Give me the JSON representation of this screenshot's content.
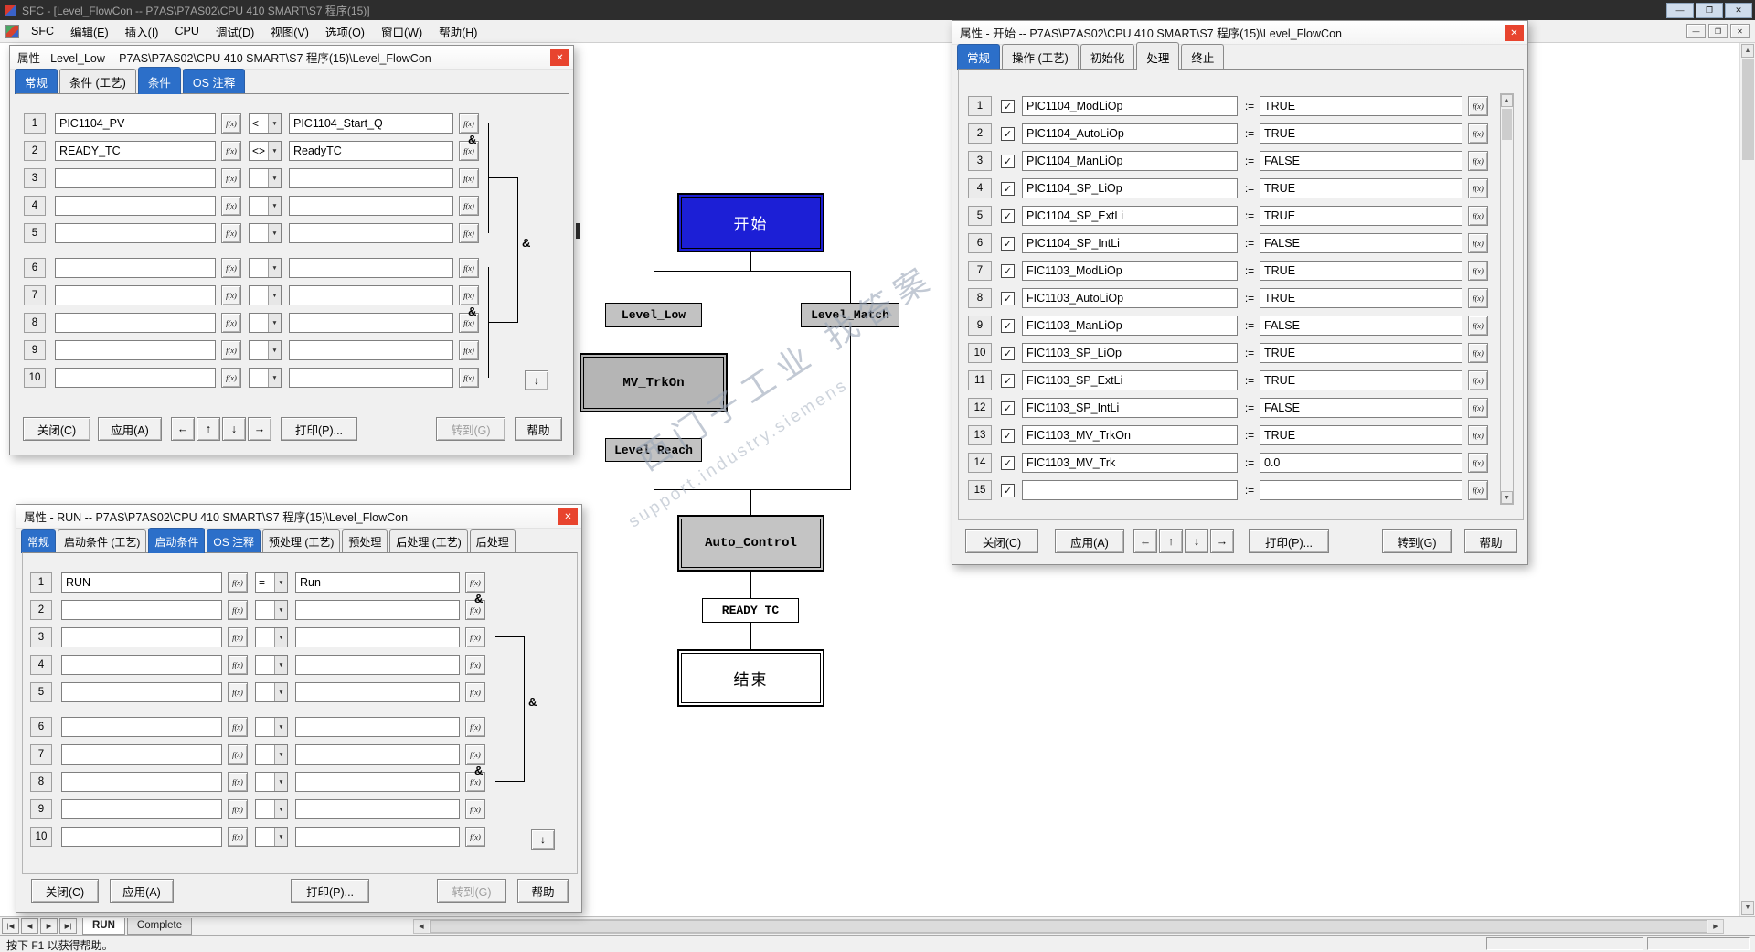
{
  "titlebar": {
    "title": "SFC - [Level_FlowCon -- P7AS\\P7AS02\\CPU 410 SMART\\S7 程序(15)]"
  },
  "menubar": {
    "items": [
      "SFC",
      "编辑(E)",
      "插入(I)",
      "CPU",
      "调试(D)",
      "视图(V)",
      "选项(O)",
      "窗口(W)",
      "帮助(H)"
    ]
  },
  "symbols": {
    "and": "&",
    "fx": "f(x)",
    "assign": ":=",
    "check": "✓",
    "arrow_left": "←",
    "arrow_up": "↑",
    "arrow_down": "↓",
    "arrow_right": "→"
  },
  "icons": {
    "minimize": "—",
    "restore": "❐",
    "close": "✕",
    "scroll_up": "▲",
    "scroll_down": "▼",
    "combo_arrow": "▼",
    "nav_first": "|◀",
    "nav_prev": "◀",
    "nav_next": "▶",
    "nav_last": "▶|",
    "hscroll_left": "◀",
    "hscroll_right": "▶"
  },
  "flowchart": {
    "start": "开始",
    "level_low": "Level_Low",
    "level_match": "Level_Match",
    "mv_trkon": "MV_TrkOn",
    "level_reach": "Level_Reach",
    "auto_control": "Auto_Control",
    "ready_tc": "READY_TC",
    "end": "结束"
  },
  "watermark": {
    "line1": "西门子工业 找答案",
    "line2": "support.industry.siemens"
  },
  "dialog_level_low": {
    "title": "属性 - Level_Low -- P7AS\\P7AS02\\CPU 410 SMART\\S7 程序(15)\\Level_FlowCon",
    "tabs": [
      {
        "label": "常规",
        "blue": true
      },
      {
        "label": "条件 (工艺)"
      },
      {
        "label": "条件",
        "blue": true,
        "active": true
      },
      {
        "label": "OS 注释",
        "blue": true
      }
    ],
    "rows": [
      {
        "n": "1",
        "lhs": "PIC1104_PV",
        "op": "<",
        "rhs": "PIC1104_Start_Q"
      },
      {
        "n": "2",
        "lhs": "READY_TC",
        "op": "<>",
        "rhs": "ReadyTC"
      },
      {
        "n": "3",
        "lhs": "",
        "op": "",
        "rhs": ""
      },
      {
        "n": "4",
        "lhs": "",
        "op": "",
        "rhs": ""
      },
      {
        "n": "5",
        "lhs": "",
        "op": "",
        "rhs": ""
      },
      {
        "n": "6",
        "lhs": "",
        "op": "",
        "rhs": ""
      },
      {
        "n": "7",
        "lhs": "",
        "op": "",
        "rhs": ""
      },
      {
        "n": "8",
        "lhs": "",
        "op": "",
        "rhs": ""
      },
      {
        "n": "9",
        "lhs": "",
        "op": "",
        "rhs": ""
      },
      {
        "n": "10",
        "lhs": "",
        "op": "",
        "rhs": ""
      }
    ],
    "buttons": {
      "close": "关闭(C)",
      "apply": "应用(A)",
      "print": "打印(P)...",
      "goto": "转到(G)",
      "help": "帮助"
    }
  },
  "dialog_run": {
    "title": "属性 - RUN -- P7AS\\P7AS02\\CPU 410 SMART\\S7 程序(15)\\Level_FlowCon",
    "tabs": [
      {
        "label": "常规",
        "blue": true
      },
      {
        "label": "启动条件 (工艺)"
      },
      {
        "label": "启动条件",
        "blue": true,
        "active": true
      },
      {
        "label": "OS 注释",
        "blue": true
      },
      {
        "label": "预处理 (工艺)"
      },
      {
        "label": "预处理"
      },
      {
        "label": "后处理 (工艺)"
      },
      {
        "label": "后处理"
      }
    ],
    "rows": [
      {
        "n": "1",
        "lhs": "RUN",
        "op": "=",
        "rhs": "Run"
      },
      {
        "n": "2",
        "lhs": "",
        "op": "",
        "rhs": ""
      },
      {
        "n": "3",
        "lhs": "",
        "op": "",
        "rhs": ""
      },
      {
        "n": "4",
        "lhs": "",
        "op": "",
        "rhs": ""
      },
      {
        "n": "5",
        "lhs": "",
        "op": "",
        "rhs": ""
      },
      {
        "n": "6",
        "lhs": "",
        "op": "",
        "rhs": ""
      },
      {
        "n": "7",
        "lhs": "",
        "op": "",
        "rhs": ""
      },
      {
        "n": "8",
        "lhs": "",
        "op": "",
        "rhs": ""
      },
      {
        "n": "9",
        "lhs": "",
        "op": "",
        "rhs": ""
      },
      {
        "n": "10",
        "lhs": "",
        "op": "",
        "rhs": ""
      }
    ],
    "buttons": {
      "close": "关闭(C)",
      "apply": "应用(A)",
      "print": "打印(P)...",
      "goto": "转到(G)",
      "help": "帮助"
    }
  },
  "dialog_start": {
    "title": "属性 - 开始 -- P7AS\\P7AS02\\CPU 410 SMART\\S7 程序(15)\\Level_FlowCon",
    "tabs": [
      {
        "label": "常规",
        "blue": true
      },
      {
        "label": "操作 (工艺)"
      },
      {
        "label": "初始化"
      },
      {
        "label": "处理",
        "active": true
      },
      {
        "label": "终止"
      }
    ],
    "rows": [
      {
        "n": "1",
        "checked": true,
        "name": "PIC1104_ModLiOp",
        "value": "TRUE"
      },
      {
        "n": "2",
        "checked": true,
        "name": "PIC1104_AutoLiOp",
        "value": "TRUE"
      },
      {
        "n": "3",
        "checked": true,
        "name": "PIC1104_ManLiOp",
        "value": "FALSE"
      },
      {
        "n": "4",
        "checked": true,
        "name": "PIC1104_SP_LiOp",
        "value": "TRUE"
      },
      {
        "n": "5",
        "checked": true,
        "name": "PIC1104_SP_ExtLi",
        "value": "TRUE"
      },
      {
        "n": "6",
        "checked": true,
        "name": "PIC1104_SP_IntLi",
        "value": "FALSE"
      },
      {
        "n": "7",
        "checked": true,
        "name": "FIC1103_ModLiOp",
        "value": "TRUE"
      },
      {
        "n": "8",
        "checked": true,
        "name": "FIC1103_AutoLiOp",
        "value": "TRUE"
      },
      {
        "n": "9",
        "checked": true,
        "name": "FIC1103_ManLiOp",
        "value": "FALSE"
      },
      {
        "n": "10",
        "checked": true,
        "name": "FIC1103_SP_LiOp",
        "value": "TRUE"
      },
      {
        "n": "11",
        "checked": true,
        "name": "FIC1103_SP_ExtLi",
        "value": "TRUE"
      },
      {
        "n": "12",
        "checked": true,
        "name": "FIC1103_SP_IntLi",
        "value": "FALSE"
      },
      {
        "n": "13",
        "checked": true,
        "name": "FIC1103_MV_TrkOn",
        "value": "TRUE"
      },
      {
        "n": "14",
        "checked": true,
        "name": "FIC1103_MV_Trk",
        "value": "0.0"
      },
      {
        "n": "15",
        "checked": true,
        "name": "",
        "value": ""
      }
    ],
    "buttons": {
      "close": "关闭(C)",
      "apply": "应用(A)",
      "print": "打印(P)...",
      "goto": "转到(G)",
      "help": "帮助"
    }
  },
  "sheetbar": {
    "tabs": [
      {
        "label": "RUN",
        "active": true
      },
      {
        "label": "Complete"
      }
    ]
  },
  "statusbar": {
    "help_text": "按下 F1 以获得帮助。"
  }
}
